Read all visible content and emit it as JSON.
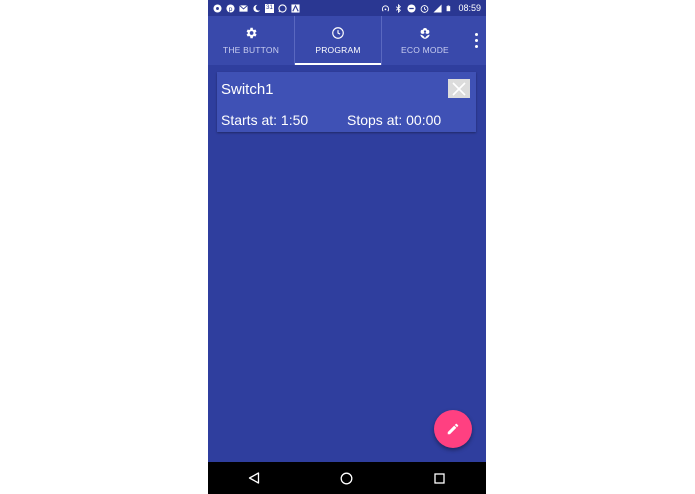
{
  "status_bar": {
    "time": "08:59",
    "left_icons": [
      "app-icon",
      "pinterest-icon",
      "gmail-icon",
      "moon-icon",
      "calendar-icon",
      "whatsapp-icon",
      "maps-icon"
    ],
    "right_icons": [
      "hotspot-icon",
      "bluetooth-icon",
      "dnd-icon",
      "alarm-icon",
      "signal-icon",
      "battery-icon"
    ],
    "calendar_day": "31"
  },
  "tabs": [
    {
      "label": "THE BUTTON",
      "icon": "gear-icon",
      "active": false
    },
    {
      "label": "PROGRAM",
      "icon": "clock-icon",
      "active": true
    },
    {
      "label": "ECO MODE",
      "icon": "flower-icon",
      "active": false
    }
  ],
  "card": {
    "title": "Switch1",
    "starts": "Starts at: 1:50",
    "stops": "Stops at: 00:00"
  },
  "colors": {
    "primary": "#3949ab",
    "background": "#2f3e9e",
    "card": "#3f51b5",
    "accent": "#ff4081"
  }
}
